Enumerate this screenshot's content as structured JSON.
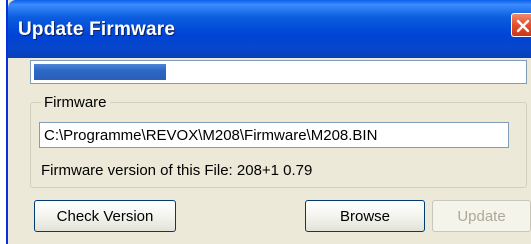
{
  "window": {
    "title": "Update Firmware",
    "close_icon": "close-icon"
  },
  "progress": {
    "fraction": 0.27
  },
  "firmware_group": {
    "label": "Firmware",
    "path_value": "C:\\Programme\\REVOX\\M208\\Firmware\\M208.BIN",
    "version_text": "Firmware version of this File: 208+1 0.79"
  },
  "buttons": {
    "check_version": "Check Version",
    "browse": "Browse",
    "update": "Update"
  },
  "colors": {
    "titlebar": "#0044d6",
    "close_button": "#e2512d",
    "progress_fill": "#2c68c6",
    "window_bg": "#ece9d8"
  }
}
